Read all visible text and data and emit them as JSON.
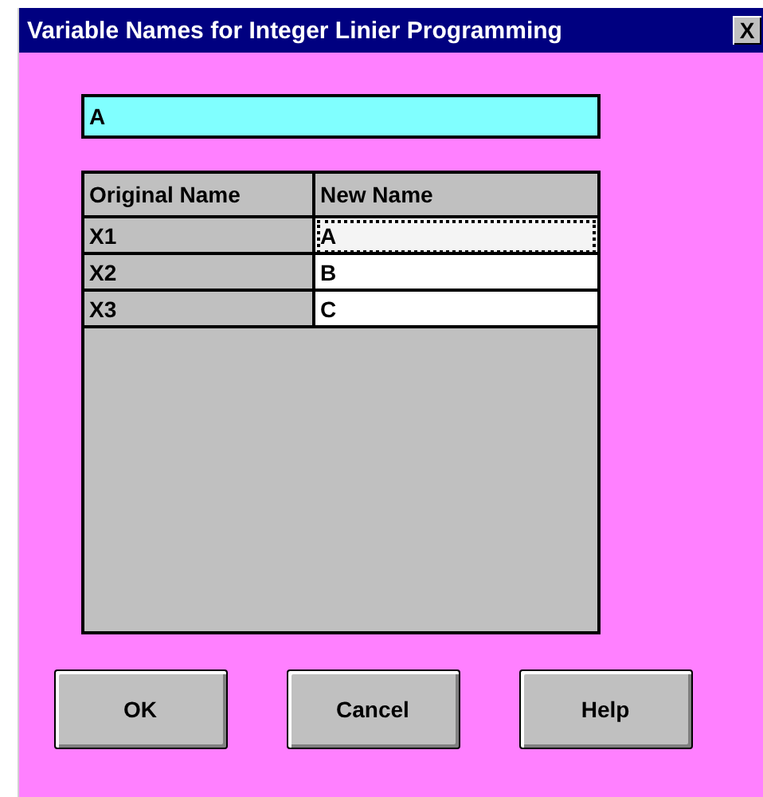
{
  "window": {
    "title": "Variable Names for Integer Linier Programming",
    "close": "X"
  },
  "edit_field": {
    "value": "A"
  },
  "table": {
    "columns": [
      "Original Name",
      "New Name"
    ],
    "rows": [
      {
        "original": "X1",
        "new": "A",
        "focused": true
      },
      {
        "original": "X2",
        "new": "B",
        "focused": false
      },
      {
        "original": "X3",
        "new": "C",
        "focused": false
      }
    ]
  },
  "buttons": [
    "OK",
    "Cancel",
    "Help"
  ]
}
